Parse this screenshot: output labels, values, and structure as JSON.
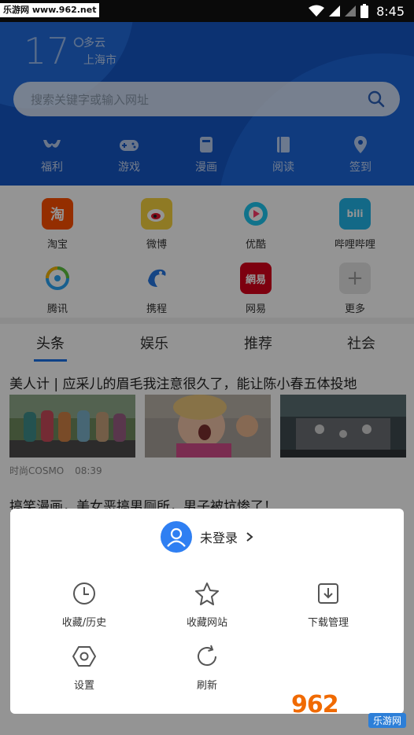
{
  "status_bar": {
    "time": "8:45",
    "watermark": "乐游网 www.962.net"
  },
  "weather": {
    "temperature": "17°",
    "condition": "多云",
    "city": "上海市"
  },
  "search": {
    "placeholder": "搜索关键字或输入网址"
  },
  "nav": [
    {
      "label": "福利",
      "icon": "bra-icon"
    },
    {
      "label": "游戏",
      "icon": "gamepad-icon"
    },
    {
      "label": "漫画",
      "icon": "comic-icon"
    },
    {
      "label": "阅读",
      "icon": "book-icon"
    },
    {
      "label": "签到",
      "icon": "location-pin-icon"
    }
  ],
  "apps": [
    {
      "label": "淘宝",
      "icon": "taobao-icon",
      "color": "#ff5000",
      "glyph": "淘"
    },
    {
      "label": "微博",
      "icon": "weibo-icon",
      "color": "#f5c518",
      "glyph": ""
    },
    {
      "label": "优酷",
      "icon": "youku-icon",
      "color": "#ffffff",
      "glyph": ""
    },
    {
      "label": "哔哩哔哩",
      "icon": "bilibili-icon",
      "color": "#22b6e8",
      "glyph": "bili"
    },
    {
      "label": "腾讯",
      "icon": "tencent-icon",
      "color": "#ffffff",
      "glyph": ""
    },
    {
      "label": "携程",
      "icon": "ctrip-icon",
      "color": "#ffffff",
      "glyph": ""
    },
    {
      "label": "网易",
      "icon": "netease-icon",
      "color": "#d8001b",
      "glyph": "網易"
    },
    {
      "label": "更多",
      "icon": "plus-icon",
      "color": "#e6e6e6",
      "glyph": "+"
    }
  ],
  "tabs": [
    {
      "label": "头条"
    },
    {
      "label": "娱乐"
    },
    {
      "label": "推荐"
    },
    {
      "label": "社会"
    }
  ],
  "news": [
    {
      "title": "美人计 | 应采儿的眉毛我注意很久了，能让陈小春五体投地",
      "source": "时尚COSMO",
      "time": "08:39"
    },
    {
      "title": "搞笑漫画，美女恶搞男厕所，男子被坑惨了！"
    }
  ],
  "sheet": {
    "login_label": "未登录",
    "items": [
      {
        "label": "收藏/历史",
        "icon": "clock-icon"
      },
      {
        "label": "收藏网站",
        "icon": "star-icon"
      },
      {
        "label": "下载管理",
        "icon": "download-icon"
      },
      {
        "label": "设置",
        "icon": "settings-icon"
      },
      {
        "label": "刷新",
        "icon": "refresh-icon"
      }
    ]
  },
  "watermark_br": {
    "text": "962",
    "site": "乐游网"
  }
}
